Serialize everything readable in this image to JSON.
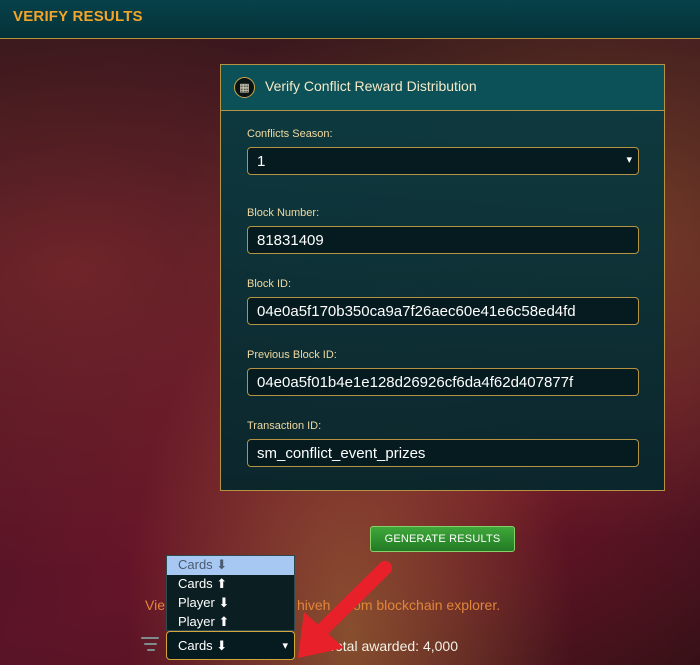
{
  "header": {
    "title": "VERIFY RESULTS"
  },
  "panel": {
    "title": "Verify Conflict Reward Distribution",
    "icon": "vault-icon",
    "fields": {
      "season_label": "Conflicts Season:",
      "season_value": "1",
      "block_number_label": "Block Number:",
      "block_number_value": "81831409",
      "block_id_label": "Block ID:",
      "block_id_value": "04e0a5f170b350ca9a7f26aec60e41e6c58ed4fd",
      "prev_block_id_label": "Previous Block ID:",
      "prev_block_id_value": "04e0a5f01b4e1e128d26926cf6da4f62d407877f",
      "transaction_id_label": "Transaction ID:",
      "transaction_id_value": "sm_conflict_event_prizes"
    }
  },
  "generate_button": {
    "label": "GENERATE RESULTS"
  },
  "explorer_text": {
    "left": "Vie",
    "right": "hiveh   .com blockchain explorer."
  },
  "sort": {
    "selected": "Cards ⬇",
    "options": [
      "Cards ⬇",
      "Cards ⬆",
      "Player ⬇",
      "Player ⬆"
    ]
  },
  "total": {
    "label": "Total awarded: 4,000"
  },
  "colors": {
    "accent": "#f3a52a",
    "border_gold": "#b59343",
    "button_green": "#2f9430",
    "annotation_red": "#e8202a"
  }
}
